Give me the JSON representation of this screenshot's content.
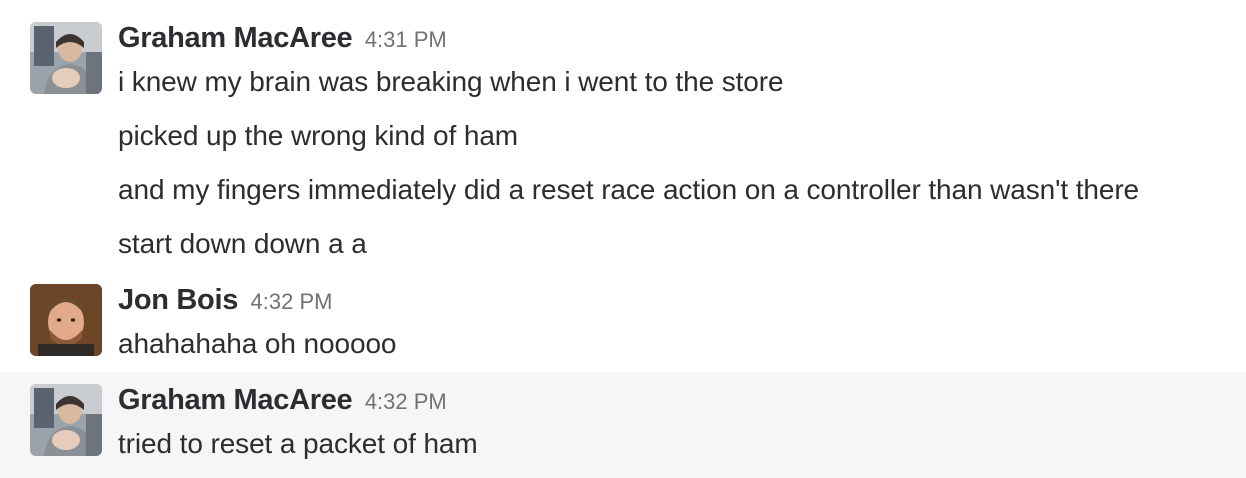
{
  "messages": [
    {
      "sender": "Graham MacAree",
      "time": "4:31 PM",
      "lines": [
        "i knew my brain was breaking when i went to the store",
        "picked up the wrong kind of ham",
        "and my fingers immediately did a reset race action on a controller than wasn't there",
        "start down down a a"
      ]
    },
    {
      "sender": "Jon Bois",
      "time": "4:32 PM",
      "lines": [
        "ahahahaha oh nooooo"
      ]
    },
    {
      "sender": "Graham MacAree",
      "time": "4:32 PM",
      "lines": [
        "tried to reset a packet of ham"
      ]
    }
  ],
  "colors": {
    "text": "#2c2d30",
    "timestamp": "#717274",
    "hover_background": "#f6f6f6"
  }
}
